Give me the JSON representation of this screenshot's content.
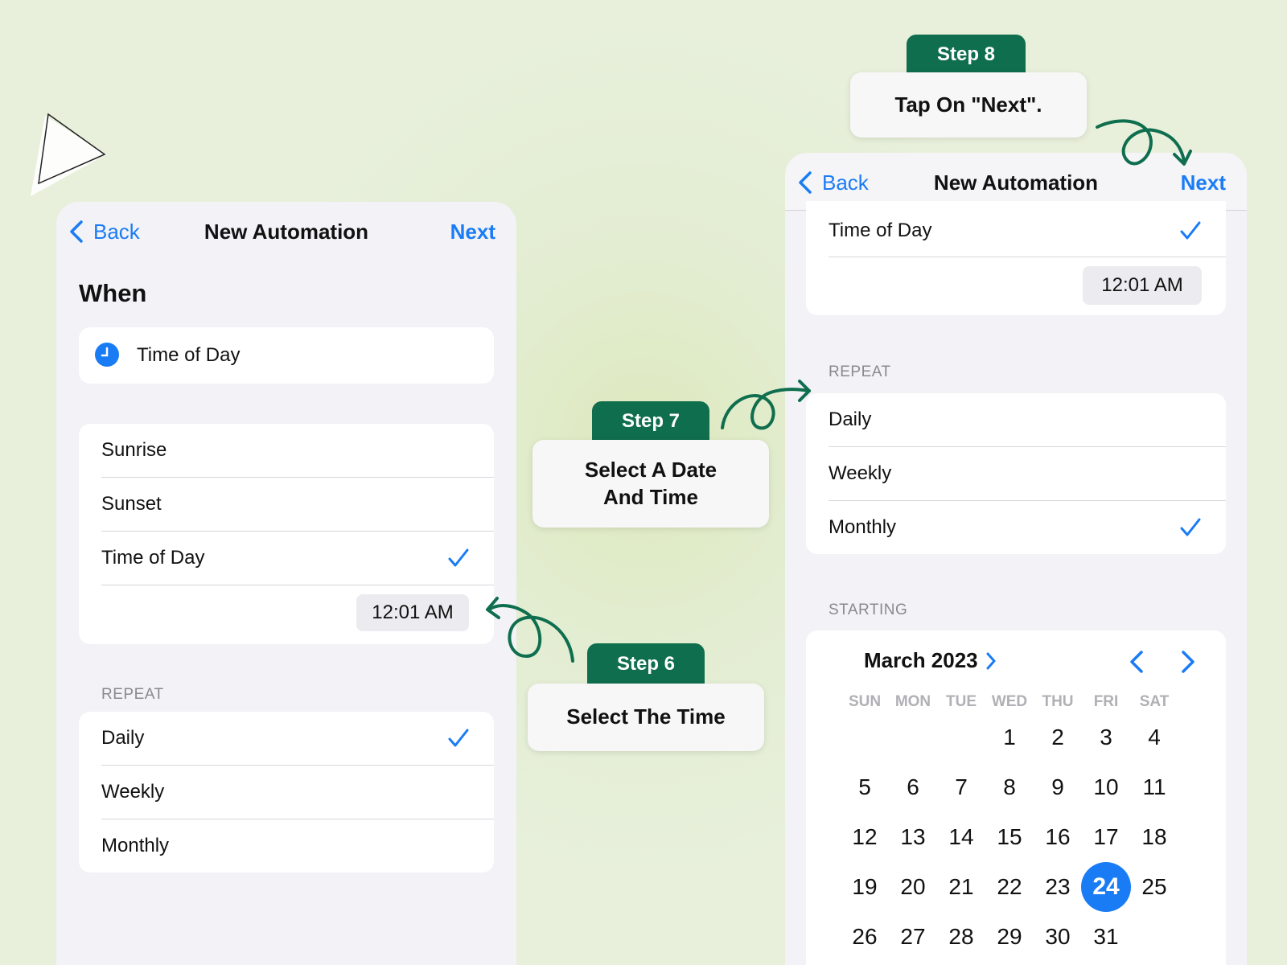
{
  "colors": {
    "ios_blue": "#1a7cf5",
    "step_green": "#0f6e4e",
    "panel_bg": "#f2f2f7",
    "background_green": "#e5eed6"
  },
  "icons": {
    "back": "chevron-left-icon",
    "check": "checkmark-icon",
    "clock": "clock-icon",
    "month_disclosure": "chevron-right-icon",
    "prev_month": "chevron-left-icon",
    "next_month": "chevron-right-icon"
  },
  "left_screen": {
    "nav": {
      "back": "Back",
      "title": "New Automation",
      "next": "Next"
    },
    "when_heading": "When",
    "trigger": "Time of Day",
    "options": [
      {
        "label": "Sunrise",
        "checked": false
      },
      {
        "label": "Sunset",
        "checked": false
      },
      {
        "label": "Time of Day",
        "checked": true
      }
    ],
    "time": "12:01 AM",
    "repeat_label": "REPEAT",
    "repeat": [
      {
        "label": "Daily",
        "checked": true
      },
      {
        "label": "Weekly",
        "checked": false
      },
      {
        "label": "Monthly",
        "checked": false
      }
    ]
  },
  "right_screen": {
    "nav": {
      "back": "Back",
      "title": "New Automation",
      "next": "Next"
    },
    "trigger": {
      "label": "Time of Day",
      "checked": true
    },
    "time": "12:01 AM",
    "repeat_label": "REPEAT",
    "repeat": [
      {
        "label": "Daily",
        "checked": false
      },
      {
        "label": "Weekly",
        "checked": false
      },
      {
        "label": "Monthly",
        "checked": true
      }
    ],
    "starting_label": "STARTING",
    "calendar": {
      "month": "March 2023",
      "weekdays": [
        "SUN",
        "MON",
        "TUE",
        "WED",
        "THU",
        "FRI",
        "SAT"
      ],
      "first_weekday_index": 3,
      "days": [
        "1",
        "2",
        "3",
        "4",
        "5",
        "6",
        "7",
        "8",
        "9",
        "10",
        "11",
        "12",
        "13",
        "14",
        "15",
        "16",
        "17",
        "18",
        "19",
        "20",
        "21",
        "22",
        "23",
        "24",
        "25",
        "26",
        "27",
        "28",
        "29",
        "30",
        "31"
      ],
      "selected_day": "24"
    }
  },
  "steps": [
    {
      "tab": "Step 6",
      "text": "Select The Time"
    },
    {
      "tab": "Step 7",
      "text": "Select A Date\nAnd Time"
    },
    {
      "tab": "Step 8",
      "text": "Tap On \"Next\"."
    }
  ]
}
